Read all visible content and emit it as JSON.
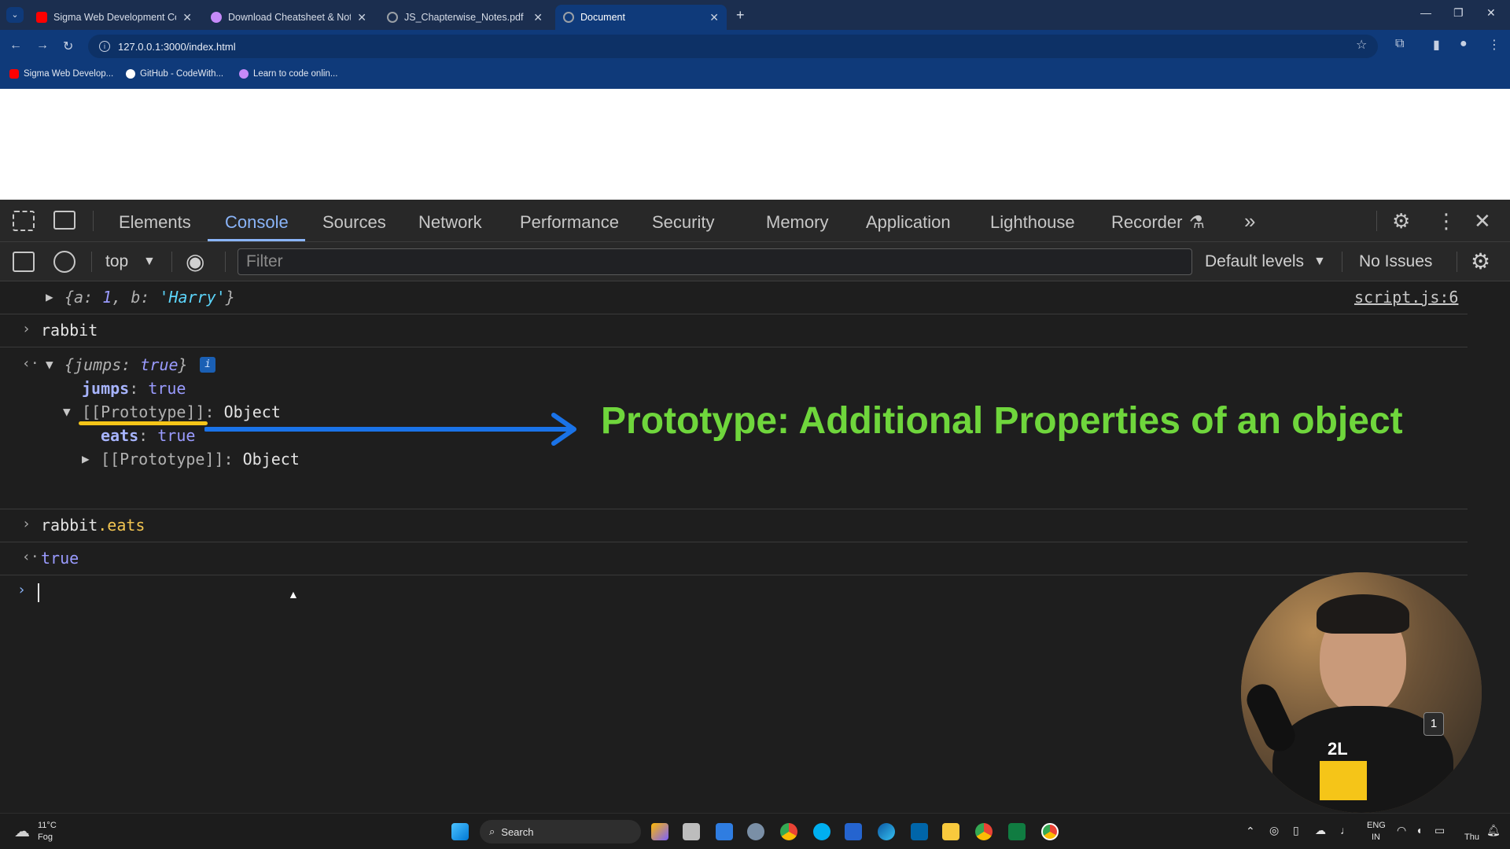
{
  "browser": {
    "tabs": [
      {
        "title": "Sigma Web Development Cour",
        "favicon": "youtube-icon",
        "color": "#ff0000",
        "active": false
      },
      {
        "title": "Download Cheatsheet & Notes",
        "favicon": "codewithharry-icon",
        "color": "#c58af9",
        "active": false
      },
      {
        "title": "JS_Chapterwise_Notes.pdf",
        "favicon": "globe-icon",
        "color": "#9aa0a6",
        "active": false
      },
      {
        "title": "Document",
        "favicon": "globe-icon",
        "color": "#9aa0a6",
        "active": true
      }
    ],
    "new_tab_label": "+",
    "url": "127.0.0.1:3000/index.html",
    "bookmarks": [
      {
        "label": "Sigma Web Develop...",
        "icon": "youtube-icon",
        "color": "#ff0000"
      },
      {
        "label": "GitHub - CodeWith...",
        "icon": "github-icon",
        "color": "#ffffff"
      },
      {
        "label": "Learn to code onlin...",
        "icon": "codewithharry-icon",
        "color": "#c58af9"
      }
    ]
  },
  "devtools": {
    "tabs": [
      "Elements",
      "Console",
      "Sources",
      "Network",
      "Performance",
      "Security",
      "Memory",
      "Application",
      "Lighthouse",
      "Recorder"
    ],
    "active_tab": "Console",
    "context": "top",
    "filter_placeholder": "Filter",
    "levels": "Default levels",
    "issues": "No Issues"
  },
  "console": {
    "log_obj": {
      "a_key": "a",
      "a_val": "1",
      "b_key": "b",
      "b_val": "'Harry'"
    },
    "source_link": "script.js:6",
    "input1": "rabbit",
    "result1": {
      "key": "jumps",
      "val": "true"
    },
    "prop_jumps": {
      "key": "jumps",
      "val": "true"
    },
    "proto1": {
      "key": "[[Prototype]]",
      "val": "Object"
    },
    "prop_eats": {
      "key": "eats",
      "val": "true"
    },
    "proto2": {
      "key": "[[Prototype]]",
      "val": "Object"
    },
    "input2": {
      "obj": "rabbit",
      "prop": ".eats"
    },
    "result2": "true",
    "annotation": "Prototype: Additional Properties of an object"
  },
  "taskbar": {
    "weather_temp": "11°C",
    "weather_desc": "Fog",
    "search_label": "Search",
    "lang_top": "ENG",
    "lang_bottom": "IN",
    "day": "Thu"
  },
  "webcam": {
    "badge": "1",
    "shirt_text": "2L"
  }
}
